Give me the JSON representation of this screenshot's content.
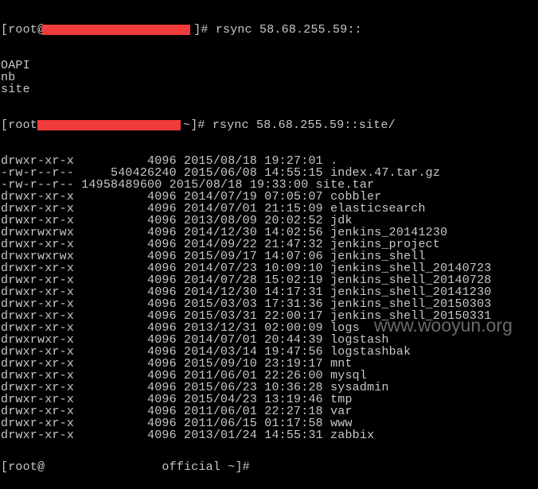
{
  "terminal": {
    "prompt1": {
      "prefix": "[root@",
      "suffix": "]# rsync 58.68.255.59::"
    },
    "modules": [
      "OAPI",
      "nb",
      "site"
    ],
    "prompt2": {
      "prefix": "[root",
      "suffix": "~]# rsync 58.68.255.59::site/"
    },
    "listing": [
      "drwxr-xr-x          4096 2015/08/18 19:27:01 .",
      "-rw-r--r--     540426240 2015/06/08 14:55:15 index.47.tar.gz",
      "-rw-r--r-- 14958489600 2015/08/18 19:33:00 site.tar",
      "drwxr-xr-x          4096 2014/07/19 07:05:07 cobbler",
      "drwxr-xr-x          4096 2014/07/01 21:15:09 elasticsearch",
      "drwxr-xr-x          4096 2013/08/09 20:02:52 jdk",
      "drwxrwxrwx          4096 2014/12/30 14:02:56 jenkins_20141230",
      "drwxr-xr-x          4096 2014/09/22 21:47:32 jenkins_project",
      "drwxrwxrwx          4096 2015/09/17 14:07:06 jenkins_shell",
      "drwxr-xr-x          4096 2014/07/23 10:09:10 jenkins_shell_20140723",
      "drwxr-xr-x          4096 2014/07/28 15:02:19 jenkins_shell_20140728",
      "drwxr-xr-x          4096 2014/12/30 14:17:31 jenkins_shell_20141230",
      "drwxr-xr-x          4096 2015/03/03 17:31:36 jenkins_shell_20150303",
      "drwxr-xr-x          4096 2015/03/31 22:00:17 jenkins_shell_20150331",
      "drwxr-xr-x          4096 2013/12/31 02:00:09 logs",
      "drwxrwxr-x          4096 2014/07/01 20:44:39 logstash",
      "drwxr-xr-x          4096 2014/03/14 19:47:56 logstashbak",
      "drwxr-xr-x          4096 2015/09/10 23:19:17 mnt",
      "drwxr-xr-x          4096 2011/06/01 22:26:00 mysql",
      "drwxr-xr-x          4096 2015/06/23 10:36:28 sysadmin",
      "drwxr-xr-x          4096 2015/04/23 13:19:46 tmp",
      "drwxr-xr-x          4096 2011/06/01 22:27:18 var",
      "drwxr-xr-x          4096 2011/06/15 01:17:58 www",
      "drwxr-xr-x          4096 2013/01/24 14:55:31 zabbix"
    ],
    "prompt3": "[root@                official ~]#",
    "redaction_color": "#f03c3c"
  },
  "watermark": "www.wooyun.org"
}
